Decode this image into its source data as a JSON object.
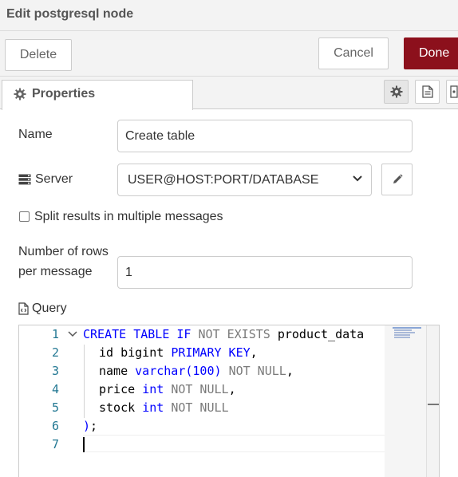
{
  "dialog": {
    "title": "Edit postgresql node"
  },
  "toolbar": {
    "delete_label": "Delete",
    "cancel_label": "Cancel",
    "done_label": "Done"
  },
  "tabs": {
    "properties_label": "Properties"
  },
  "form": {
    "name_label": "Name",
    "name_value": "Create table",
    "server_label": "Server",
    "server_value": "USER@HOST:PORT/DATABASE",
    "split_label": "Split results in multiple messages",
    "split_checked": false,
    "rows_label_line1": "Number of rows",
    "rows_label_line2": "per message",
    "rows_value": "1",
    "query_label": "Query"
  },
  "editor": {
    "line_numbers": [
      "1",
      "2",
      "3",
      "4",
      "5",
      "6",
      "7"
    ],
    "lines": {
      "l1_kw": "CREATE TABLE IF",
      "l1_not": "NOT",
      "l1_kw2": "EXISTS",
      "l1_rest": "product_data",
      "l2_id": "id bigint",
      "l2_kw": "PRIMARY KEY",
      "l2_end": ",",
      "l3_name": "name",
      "l3_type": "varchar(100)",
      "l3_null": "NOT NULL",
      "l3_end": ",",
      "l4_name": "price",
      "l4_type": "int",
      "l4_null": "NOT NULL",
      "l4_end": ",",
      "l5_name": "stock",
      "l5_type": "int",
      "l5_null": "NOT NULL",
      "l6_paren": ")",
      "l6_semi": ";"
    }
  },
  "icons": {
    "gear": "gear-icon",
    "document": "document-icon",
    "node-info": "node-info-icon",
    "server": "server-icon",
    "pencil": "pencil-icon",
    "query": "code-file-icon"
  }
}
